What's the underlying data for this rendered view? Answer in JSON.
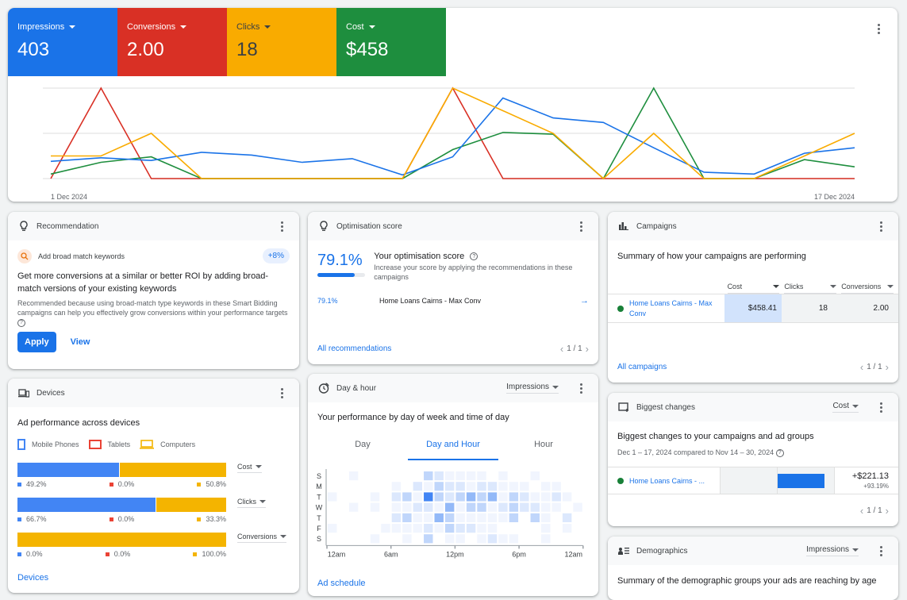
{
  "colors": {
    "impressions": "#1a73e8",
    "conversions": "#d93025",
    "clicks": "#f9ab00",
    "cost": "#1e8e3e",
    "mobile": "#4285f4",
    "tablets": "#ea4335",
    "computers": "#f4b400",
    "heat": [
      "#ffffff",
      "#f1f5fe",
      "#dce8fd",
      "#c0d6fb",
      "#93b9f8",
      "#4285f4"
    ]
  },
  "performance": {
    "tiles": [
      {
        "label": "Impressions",
        "value": "403"
      },
      {
        "label": "Conversions",
        "value": "2.00"
      },
      {
        "label": "Clicks",
        "value": "18"
      },
      {
        "label": "Cost",
        "value": "$458"
      }
    ]
  },
  "chart_data": {
    "type": "line",
    "x": [
      "1 Dec",
      "2 Dec",
      "3 Dec",
      "4 Dec",
      "5 Dec",
      "6 Dec",
      "7 Dec",
      "8 Dec",
      "9 Dec",
      "10 Dec",
      "11 Dec",
      "12 Dec",
      "13 Dec",
      "14 Dec",
      "15 Dec",
      "16 Dec",
      "17 Dec"
    ],
    "x_tick_labels": [
      "1 Dec 2024",
      "17 Dec 2024"
    ],
    "grid": true,
    "normalized": true,
    "ylim": [
      0,
      1
    ],
    "series": [
      {
        "name": "Impressions",
        "values": [
          0.19,
          0.23,
          0.2,
          0.29,
          0.26,
          0.18,
          0.22,
          0.04,
          0.24,
          0.89,
          0.67,
          0.62,
          0.34,
          0.07,
          0.05,
          0.28,
          0.34
        ]
      },
      {
        "name": "Conversions",
        "values": [
          0,
          1,
          0,
          0,
          0,
          0,
          0,
          0,
          1,
          0,
          0,
          0,
          0,
          0,
          0,
          0,
          0
        ]
      },
      {
        "name": "Clicks",
        "values": [
          0.25,
          0.25,
          0.5,
          0,
          0,
          0,
          0,
          0,
          1,
          0.75,
          0.5,
          0,
          0.5,
          0,
          0,
          0.25,
          0.5
        ]
      },
      {
        "name": "Cost",
        "values": [
          0.05,
          0.18,
          0.24,
          0,
          0,
          0,
          0,
          0,
          0.32,
          0.51,
          0.49,
          0,
          1,
          0,
          0,
          0.21,
          0.13
        ]
      }
    ]
  },
  "recommendation": {
    "title": "Recommendation",
    "item": "Add broad match keywords",
    "uplift": "+8%",
    "headline": "Get more conversions at a similar or better ROI by adding broad-match versions of your existing keywords",
    "reason": "Recommended because using broad-match type keywords in these Smart Bidding campaigns can help you effectively grow conversions within your performance targets",
    "apply": "Apply",
    "view": "View"
  },
  "optimisation": {
    "title": "Optimisation score",
    "score": "79.1%",
    "score_fraction": 0.791,
    "heading": "Your optimisation score",
    "desc": "Increase your score by applying the recommendations in these campaigns",
    "rows": [
      {
        "pct": "79.1%",
        "campaign": "Home Loans Cairns - Max Conv"
      }
    ],
    "all_link": "All recommendations",
    "pager": "1 / 1"
  },
  "campaigns": {
    "title": "Campaigns",
    "subtitle": "Summary of how your campaigns are performing",
    "columns": [
      "Cost",
      "Clicks",
      "Conversions"
    ],
    "rows": [
      {
        "name": "Home Loans Cairns - Max Conv",
        "cost": "$458.41",
        "clicks": "18",
        "conversions": "2.00"
      }
    ],
    "all_link": "All campaigns",
    "pager": "1 / 1"
  },
  "devices": {
    "title": "Devices",
    "subtitle": "Ad performance across devices",
    "legend": [
      "Mobile Phones",
      "Tablets",
      "Computers"
    ],
    "metrics": [
      {
        "metric": "Cost",
        "mobile": 49.2,
        "tablets": 0.0,
        "computers": 50.8,
        "labels": [
          "49.2%",
          "0.0%",
          "50.8%"
        ]
      },
      {
        "metric": "Clicks",
        "mobile": 66.7,
        "tablets": 0.0,
        "computers": 33.3,
        "labels": [
          "66.7%",
          "0.0%",
          "33.3%"
        ]
      },
      {
        "metric": "Conversions",
        "mobile": 0.0,
        "tablets": 0.0,
        "computers": 100.0,
        "labels": [
          "0.0%",
          "0.0%",
          "100.0%"
        ]
      }
    ],
    "link": "Devices"
  },
  "dayhour": {
    "title": "Day & hour",
    "metric": "Impressions",
    "subtitle": "Your performance by day of week and time of day",
    "tabs": [
      "Day",
      "Day and Hour",
      "Hour"
    ],
    "active_tab": 1,
    "days": [
      "S",
      "M",
      "T",
      "W",
      "T",
      "F",
      "S"
    ],
    "hour_labels": [
      "12am",
      "6am",
      "12pm",
      "6pm",
      "12am"
    ],
    "grid": [
      [
        0,
        0,
        1,
        0,
        0,
        0,
        0,
        0,
        0,
        3,
        2,
        1,
        1,
        1,
        1,
        0,
        1,
        0,
        0,
        1,
        0,
        0,
        0,
        0
      ],
      [
        0,
        0,
        0,
        0,
        0,
        0,
        1,
        0,
        2,
        1,
        3,
        2,
        2,
        1,
        2,
        2,
        1,
        1,
        1,
        0,
        1,
        1,
        0,
        0
      ],
      [
        1,
        0,
        0,
        0,
        1,
        0,
        2,
        3,
        1,
        5,
        3,
        2,
        3,
        4,
        3,
        4,
        1,
        3,
        2,
        1,
        1,
        2,
        1,
        0
      ],
      [
        0,
        0,
        1,
        0,
        1,
        0,
        1,
        1,
        2,
        2,
        1,
        4,
        1,
        3,
        3,
        1,
        2,
        3,
        2,
        2,
        1,
        1,
        0,
        1
      ],
      [
        0,
        0,
        0,
        0,
        0,
        0,
        2,
        3,
        1,
        1,
        4,
        3,
        1,
        1,
        1,
        1,
        1,
        3,
        0,
        3,
        1,
        0,
        2,
        0
      ],
      [
        1,
        0,
        0,
        0,
        0,
        1,
        1,
        1,
        1,
        2,
        1,
        3,
        2,
        2,
        1,
        1,
        0,
        0,
        0,
        0,
        1,
        0,
        1,
        0
      ],
      [
        0,
        0,
        0,
        0,
        1,
        0,
        0,
        1,
        0,
        3,
        0,
        1,
        1,
        0,
        1,
        2,
        1,
        1,
        0,
        0,
        1,
        0,
        0,
        0
      ]
    ],
    "link": "Ad schedule"
  },
  "biggest": {
    "title": "Biggest changes",
    "metric": "Cost",
    "subtitle": "Biggest changes to your campaigns and ad groups",
    "date_range": "Dec 1 – 17, 2024 compared to Nov 14 – 30, 2024",
    "rows": [
      {
        "name": "Home Loans Cairns - ...",
        "change": "+$221.13",
        "pct": "+93.19%",
        "bar_fraction": 0.83
      }
    ],
    "pager": "1 / 1"
  },
  "demographics": {
    "title": "Demographics",
    "metric": "Impressions",
    "subtitle": "Summary of the demographic groups your ads are reaching by age"
  }
}
